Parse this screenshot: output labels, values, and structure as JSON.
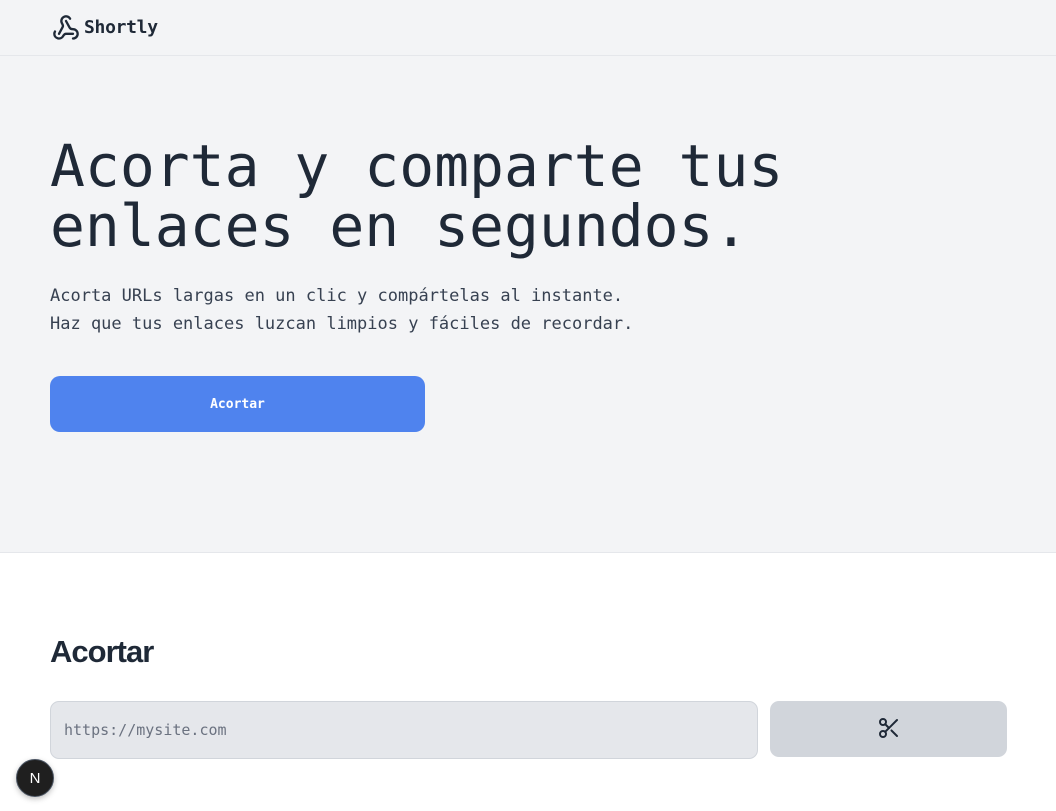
{
  "header": {
    "brand": "Shortly",
    "logo_icon": "webhook-icon"
  },
  "hero": {
    "title": "Acorta y comparte tus enlaces en segundos.",
    "subtitle_lines": [
      "Acorta URLs largas en un clic y compártelas al instante.",
      "Haz que tus enlaces luzcan limpios y fáciles de recordar."
    ],
    "cta_label": "Acortar"
  },
  "shorten": {
    "title": "Acortar",
    "input_placeholder": "https://mysite.com",
    "input_value": "",
    "button_icon": "scissors-icon"
  },
  "dev_badge": {
    "label": "N",
    "icon": "nextjs-icon"
  },
  "colors": {
    "accent": "#4f83ee",
    "hero_bg": "#f3f4f6",
    "text": "#1f2937",
    "button_secondary": "#d1d5db"
  }
}
